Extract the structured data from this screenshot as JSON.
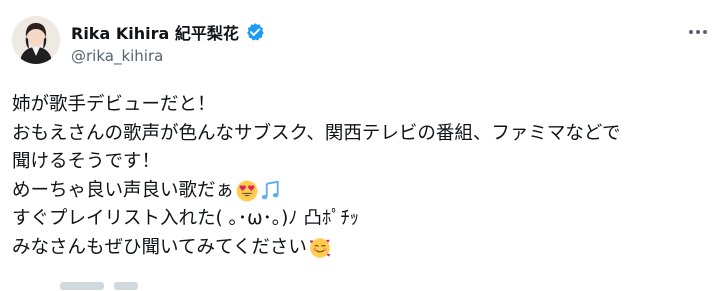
{
  "author": {
    "display_name": "Rika Kihira 紀平梨花",
    "handle": "@rika_kihira",
    "verified_color": "#1d9bf0"
  },
  "tweet": {
    "lines": [
      "姉が歌手デビューだと！",
      "おもえさんの歌声が色んなサブスク、関西テレビの番組、ファミマなどで",
      "聞けるそうです！",
      "めーちゃ良い声良い歌だぁ",
      "すぐプレイリスト入れた( ｡･ω･｡)ﾉ 凸ﾎﾟﾁｯ",
      "みなさんもぜひ聞いてみてください"
    ],
    "emojis": {
      "line4": [
        "heart-eyes-emoji",
        "music-notes-emoji"
      ],
      "line6": [
        "smiling-hearts-emoji"
      ]
    }
  },
  "icons": {
    "more": "more-horizontal-icon",
    "verified": "verified-badge-icon"
  }
}
